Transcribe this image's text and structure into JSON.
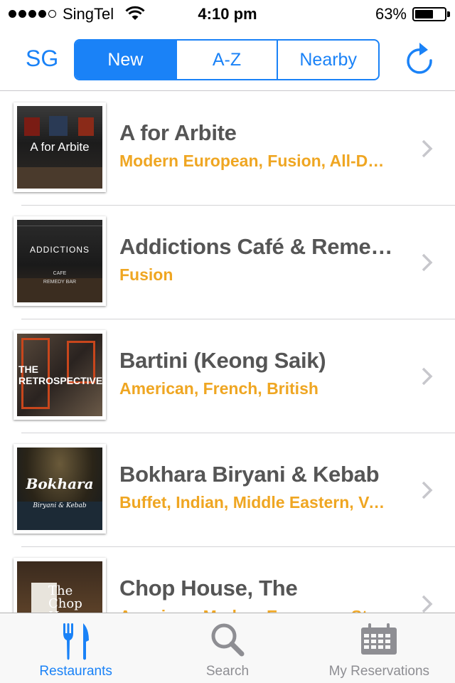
{
  "status_bar": {
    "carrier": "SingTel",
    "time": "4:10 pm",
    "battery_percent": "63%",
    "battery_level": 0.63
  },
  "nav": {
    "region": "SG",
    "segments": [
      "New",
      "A-Z",
      "Nearby"
    ],
    "selected_segment": "New"
  },
  "restaurants": [
    {
      "name": "A for Arbite",
      "cuisine": "Modern European, Fusion, All-Day Dining",
      "thumb_text": "A for Arbite"
    },
    {
      "name": "Addictions Café & Remedy Bar",
      "cuisine": "Fusion",
      "thumb_text": "ADDICTIONS"
    },
    {
      "name": "Bartini (Keong Saik)",
      "cuisine": "American, French, British",
      "thumb_text": "THE RETROSPECTIVE"
    },
    {
      "name": "Bokhara Biryani & Kebab",
      "cuisine": "Buffet, Indian, Middle Eastern, Vegetarian",
      "thumb_text": "Bokhara"
    },
    {
      "name": "Chop House, The",
      "cuisine": "American, Modern European, Steakhouse",
      "thumb_text": "The Chop House"
    }
  ],
  "thumb_extras": {
    "addictions_sub": "CAFE",
    "addictions_sub2": "REMEDY BAR",
    "bokhara_sub": "Biryani & Kebab"
  },
  "tabs": [
    {
      "label": "Restaurants",
      "icon": "fork-knife-icon",
      "active": true
    },
    {
      "label": "Search",
      "icon": "magnifier-icon",
      "active": false
    },
    {
      "label": "My Reservations",
      "icon": "calendar-icon",
      "active": false
    }
  ],
  "colors": {
    "accent": "#1a82f7",
    "cuisine": "#efa622",
    "name": "#555555"
  }
}
